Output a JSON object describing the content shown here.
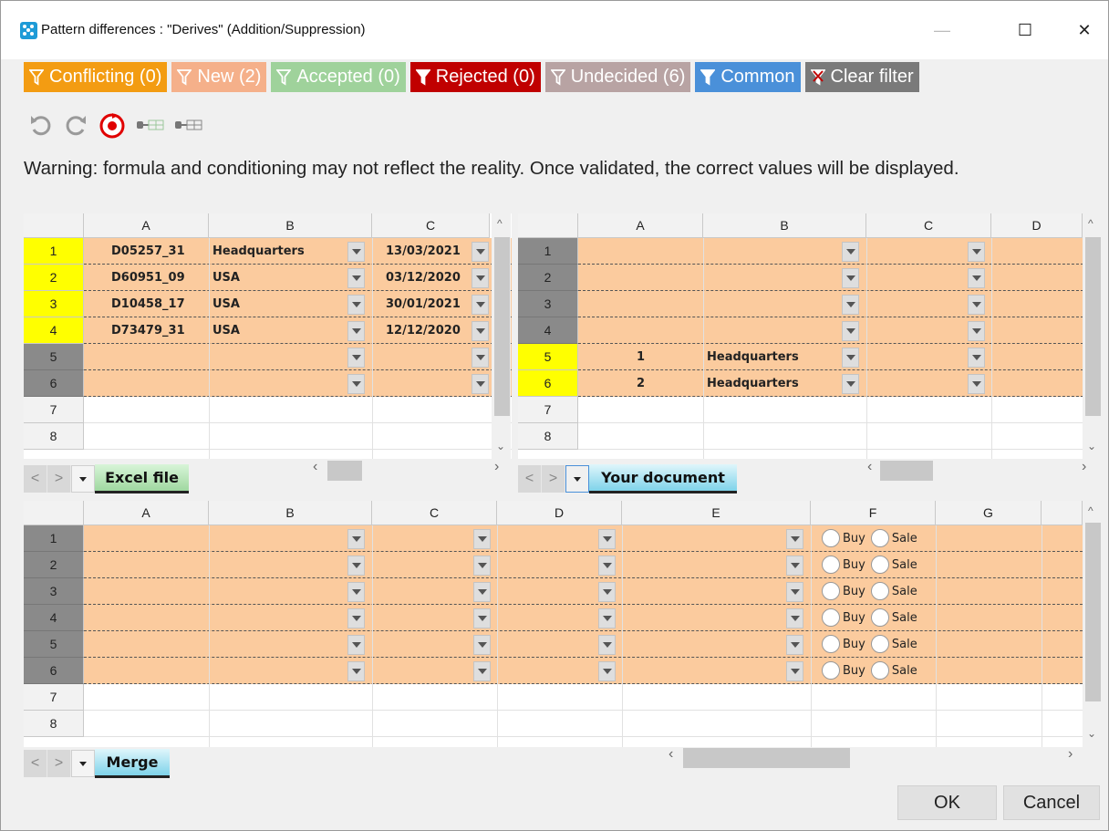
{
  "window": {
    "title": "Pattern differences : \"Derives\" (Addition/Suppression)",
    "controls": {
      "minimize": "—",
      "maximize": "☐",
      "close": "✕"
    }
  },
  "filters": [
    {
      "label": "Conflicting (0)",
      "color": "#f39c12",
      "text_color": "#ffffff"
    },
    {
      "label": "New (2)",
      "color": "#f5b08a",
      "text_color": "#ffffff"
    },
    {
      "label": "Accepted (0)",
      "color": "#9fd29b",
      "text_color": "#ffffff"
    },
    {
      "label": "Rejected (0)",
      "color": "#c00000",
      "text_color": "#ffffff"
    },
    {
      "label": "Undecided (6)",
      "color": "#b8a3a3",
      "text_color": "#ffffff"
    },
    {
      "label": "Common",
      "color": "#4a90d9",
      "text_color": "#ffffff"
    },
    {
      "label": "Clear filter",
      "color": "#7a7a7a",
      "text_color": "#ffffff"
    }
  ],
  "toolbar": {
    "icons": [
      "undo-icon",
      "redo-icon",
      "reset-icon",
      "link-left-icon",
      "link-right-icon"
    ]
  },
  "warning": "Warning: formula and conditioning may not reflect the reality. Once validated, the correct values will be displayed.",
  "grid1": {
    "columns": [
      "A",
      "B",
      "C"
    ],
    "rows": [
      {
        "n": "1",
        "A": "D05257_31",
        "B": "Headquarters",
        "C": "13/03/2021"
      },
      {
        "n": "2",
        "A": "D60951_09",
        "B": "USA",
        "C": "03/12/2020"
      },
      {
        "n": "3",
        "A": "D10458_17",
        "B": "USA",
        "C": "30/01/2021"
      },
      {
        "n": "4",
        "A": "D73479_31",
        "B": "USA",
        "C": "12/12/2020"
      },
      {
        "n": "5",
        "A": "",
        "B": "",
        "C": ""
      },
      {
        "n": "6",
        "A": "",
        "B": "",
        "C": ""
      },
      {
        "n": "7"
      },
      {
        "n": "8"
      }
    ],
    "tab": "Excel file"
  },
  "grid2": {
    "columns": [
      "A",
      "B",
      "C",
      "D"
    ],
    "rows": [
      {
        "n": "1",
        "A": "",
        "B": ""
      },
      {
        "n": "2",
        "A": "",
        "B": ""
      },
      {
        "n": "3",
        "A": "",
        "B": ""
      },
      {
        "n": "4",
        "A": "",
        "B": ""
      },
      {
        "n": "5",
        "A": "1",
        "B": "Headquarters"
      },
      {
        "n": "6",
        "A": "2",
        "B": "Headquarters"
      },
      {
        "n": "7"
      },
      {
        "n": "8"
      }
    ],
    "tab": "Your document"
  },
  "grid3": {
    "columns": [
      "A",
      "B",
      "C",
      "D",
      "E",
      "F",
      "G"
    ],
    "rows": [
      "1",
      "2",
      "3",
      "4",
      "5",
      "6",
      "7",
      "8"
    ],
    "radio_buy": "Buy",
    "radio_sale": "Sale",
    "tab": "Merge"
  },
  "buttons": {
    "ok": "OK",
    "cancel": "Cancel"
  }
}
